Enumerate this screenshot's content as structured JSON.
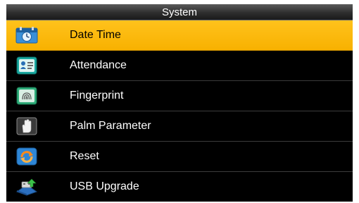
{
  "header": {
    "title": "System"
  },
  "menu": {
    "selected_index": 0,
    "items": [
      {
        "label": "Date Time",
        "icon": "calendar-clock-icon"
      },
      {
        "label": "Attendance",
        "icon": "attendance-icon"
      },
      {
        "label": "Fingerprint",
        "icon": "fingerprint-icon"
      },
      {
        "label": "Palm Parameter",
        "icon": "palm-icon"
      },
      {
        "label": "Reset",
        "icon": "reset-icon"
      },
      {
        "label": "USB Upgrade",
        "icon": "usb-upgrade-icon"
      }
    ]
  },
  "colors": {
    "selected_background": "#f8b100",
    "screen_background": "#000000",
    "text": "#ffffff"
  }
}
